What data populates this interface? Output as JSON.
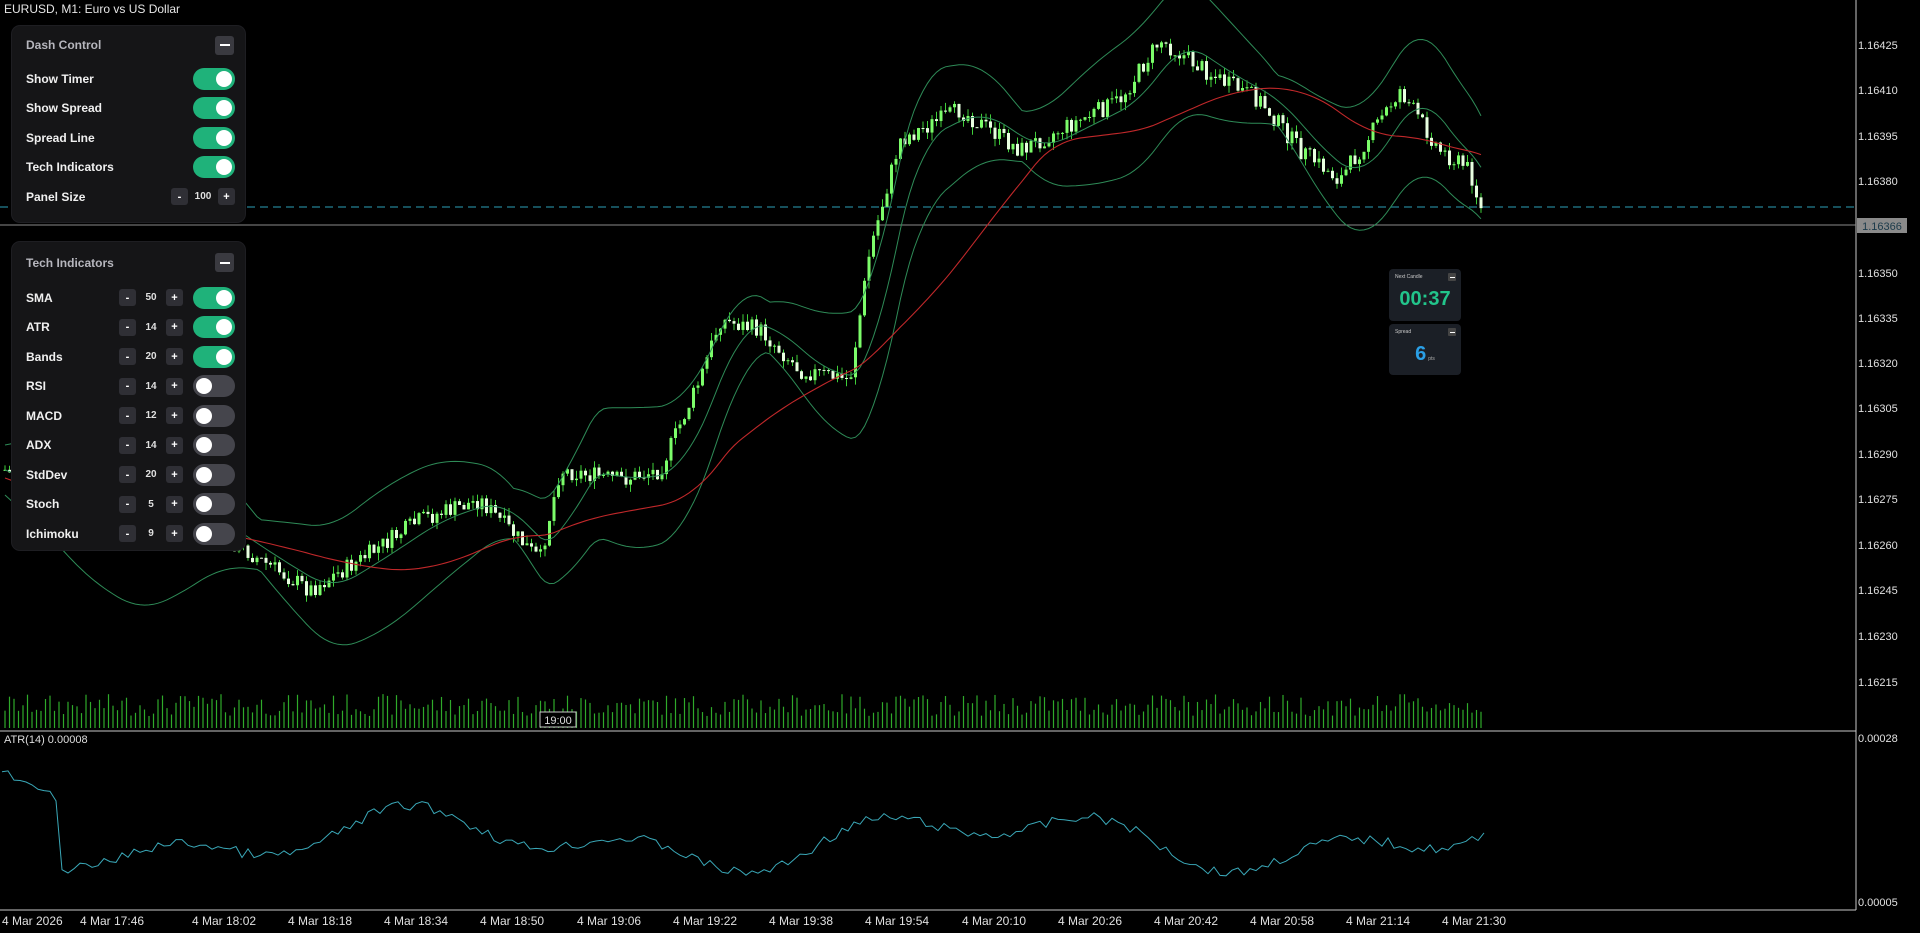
{
  "window": {
    "title": "EURUSD, M1:  Euro vs US Dollar"
  },
  "dash_control": {
    "title": "Dash Control",
    "items": [
      {
        "label": "Show Timer",
        "on": true
      },
      {
        "label": "Show Spread",
        "on": true
      },
      {
        "label": "Spread Line",
        "on": true
      },
      {
        "label": "Tech Indicators",
        "on": true
      }
    ],
    "panel_size": {
      "label": "Panel Size",
      "minus": "-",
      "value": "100",
      "plus": "+"
    }
  },
  "tech_indicators": {
    "title": "Tech Indicators",
    "items": [
      {
        "label": "SMA",
        "value": "50",
        "on": true
      },
      {
        "label": "ATR",
        "value": "14",
        "on": true
      },
      {
        "label": "Bands",
        "value": "20",
        "on": true
      },
      {
        "label": "RSI",
        "value": "14",
        "on": false
      },
      {
        "label": "MACD",
        "value": "12",
        "on": false
      },
      {
        "label": "ADX",
        "value": "14",
        "on": false
      },
      {
        "label": "StdDev",
        "value": "20",
        "on": false
      },
      {
        "label": "Stoch",
        "value": "5",
        "on": false
      },
      {
        "label": "Ichimoku",
        "value": "9",
        "on": false
      }
    ]
  },
  "timer_widget": {
    "title": "Next Candle",
    "value": "00:37",
    "color": "#22c58b"
  },
  "spread_widget": {
    "title": "Spread",
    "value": "6",
    "unit": "pts",
    "color": "#2a9fe6"
  },
  "price_axis": {
    "labels": [
      "1.16425",
      "1.16410",
      "1.16395",
      "1.16380",
      "1.16350",
      "1.16335",
      "1.16320",
      "1.16305",
      "1.16290",
      "1.16275",
      "1.16260",
      "1.16245",
      "1.16230",
      "1.16215"
    ],
    "current_price": "1.16366"
  },
  "atr_subwindow": {
    "label": "ATR(14) 0.00008",
    "max_label": "0.00028",
    "min_label": "0.00005"
  },
  "time_axis": {
    "labels": [
      "4 Mar 2026",
      "4 Mar 17:46",
      "4 Mar 18:02",
      "4 Mar 18:18",
      "4 Mar 18:34",
      "4 Mar 18:50",
      "4 Mar 19:06",
      "4 Mar 19:22",
      "4 Mar 19:38",
      "4 Mar 19:54",
      "4 Mar 20:10",
      "4 Mar 20:26",
      "4 Mar 20:42",
      "4 Mar 20:58",
      "4 Mar 21:14",
      "4 Mar 21:30"
    ],
    "crosshair_time": "19:00"
  },
  "colors": {
    "bull": "#7CFC6A",
    "bear": "#e8ffe0",
    "sma": "#c0282a",
    "bands": "#2e8b57",
    "atr": "#3aa8b8",
    "spread_line": "#1e6a7a",
    "accent": "#1fb27a"
  }
}
